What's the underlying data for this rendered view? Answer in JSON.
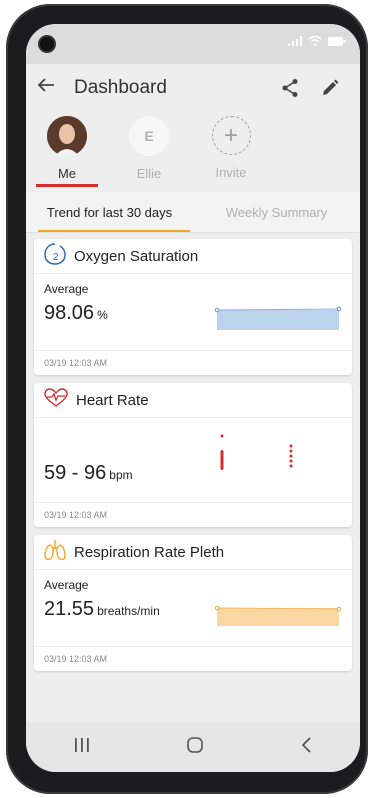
{
  "appbar": {
    "title": "Dashboard"
  },
  "profiles": [
    {
      "name": "Me",
      "initial": ""
    },
    {
      "name": "Ellie",
      "initial": "E"
    },
    {
      "name": "Invite",
      "initial": "+"
    }
  ],
  "tabs": [
    "Trend for last 30 days",
    "Weekly Summary"
  ],
  "cards": {
    "oxygen": {
      "title": "Oxygen Saturation",
      "icon": "oxygen-saturation-icon",
      "avg_label": "Average",
      "value": "98.06",
      "unit": "%",
      "timestamp": "03/19 12:03 AM",
      "color": "#bcd3ee"
    },
    "heart": {
      "title": "Heart Rate",
      "icon": "heart-rate-icon",
      "value": "59 - 96",
      "unit": "bpm",
      "timestamp": "03/19 12:03 AM",
      "color": "#d32f2f"
    },
    "resp": {
      "title": "Respiration Rate Pleth",
      "icon": "lungs-icon",
      "avg_label": "Average",
      "value": "21.55",
      "unit": "breaths/min",
      "timestamp": "03/19 12:03 AM",
      "color": "#fbd8a3"
    }
  },
  "colors": {
    "accent": "#d32f2f",
    "tab_underline": "#f5a623",
    "inactive": "#b0b0b0"
  }
}
